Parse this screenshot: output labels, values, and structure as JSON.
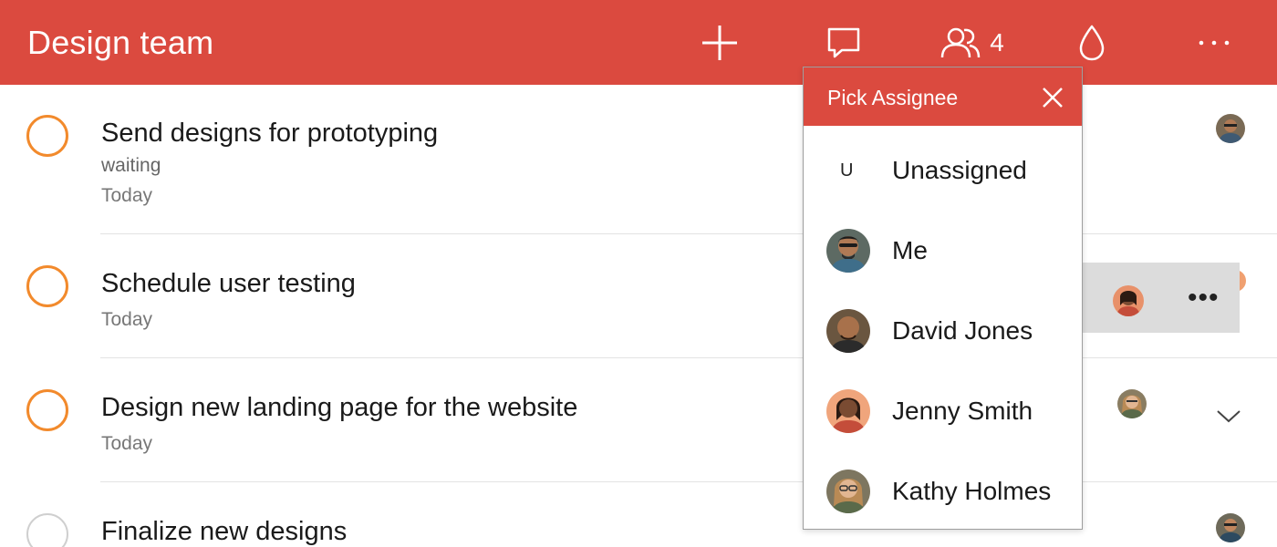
{
  "header": {
    "title": "Design team",
    "member_count": "4",
    "icons": [
      "plus-icon",
      "comment-icon",
      "people-icon",
      "drop-icon",
      "ellipsis-icon"
    ],
    "color": "#db4a3f"
  },
  "tasks": [
    {
      "name": "Send designs for prototyping",
      "note": "waiting",
      "date": "Today"
    },
    {
      "name": "Schedule user testing",
      "date": "Today"
    },
    {
      "name": "Design new landing page for the website",
      "date": "Today"
    },
    {
      "name": "Finalize new designs"
    }
  ],
  "row_actions": {
    "more_label": "•••"
  },
  "picker": {
    "title": "Pick Assignee",
    "options": [
      {
        "initial": "U",
        "name": "Unassigned"
      },
      {
        "name": "Me"
      },
      {
        "name": "David Jones"
      },
      {
        "name": "Jenny Smith"
      },
      {
        "name": "Kathy Holmes"
      }
    ]
  },
  "colors": {
    "accent": "#db4a3f",
    "checkbox": "#f28a2c"
  }
}
